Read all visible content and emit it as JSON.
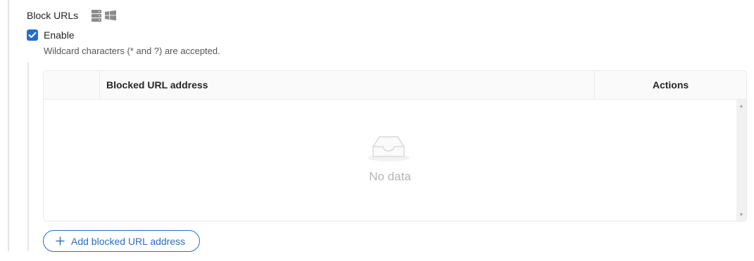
{
  "section": {
    "title": "Block URLs",
    "icons": [
      "server-icon",
      "windows-icon"
    ]
  },
  "enable": {
    "label": "Enable",
    "checked": true
  },
  "hint": "Wildcard characters (* and ?) are accepted.",
  "table": {
    "columns": [
      "",
      "Blocked URL address",
      "Actions"
    ],
    "rows": [],
    "empty_text": "No data"
  },
  "add_button": {
    "label": "Add blocked URL address",
    "icon": "plus-icon"
  },
  "colors": {
    "accent": "#1f6fd1",
    "link": "#2b6cc4",
    "border": "#eaeaea",
    "header_bg": "#fafafa",
    "muted_text": "#b5b5b5"
  }
}
